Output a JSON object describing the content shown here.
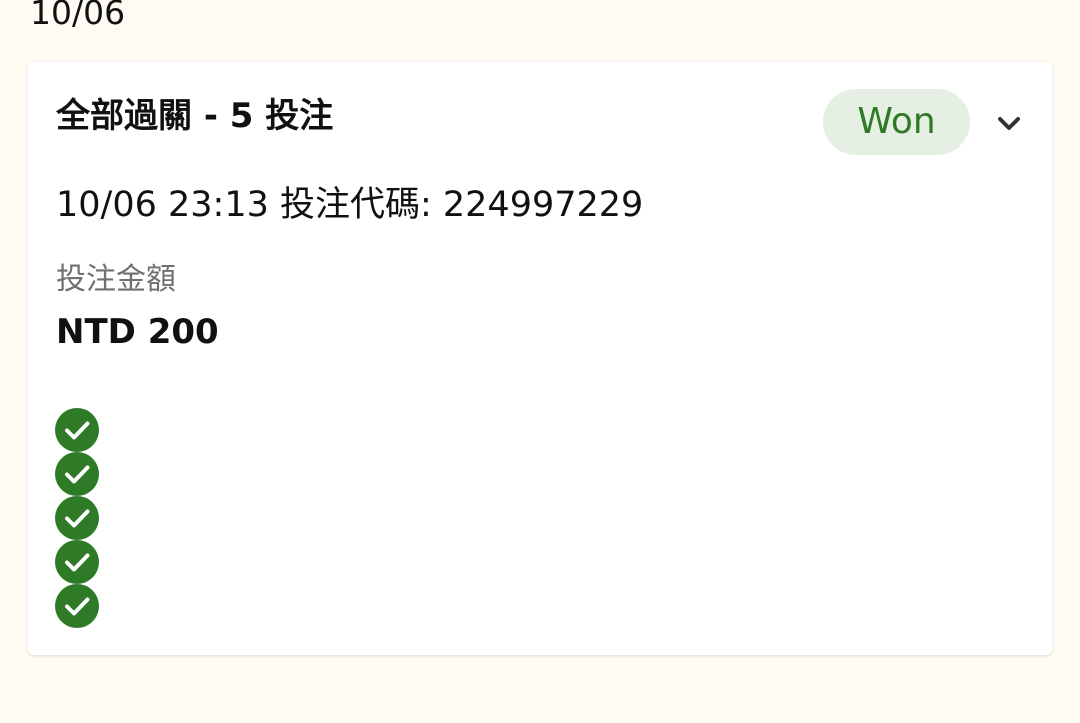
{
  "date_header": "10/06",
  "bet": {
    "title": "全部過關 - 5 投注",
    "status": "Won",
    "meta": "10/06 23:13 投注代碼: 224997229",
    "stake_label": "投注金額",
    "stake_value": "NTD 200",
    "legs": [
      {
        "icon": "check-circle-icon",
        "result": "won"
      },
      {
        "icon": "check-circle-icon",
        "result": "won"
      },
      {
        "icon": "check-circle-icon",
        "result": "won"
      },
      {
        "icon": "check-circle-icon",
        "result": "won"
      },
      {
        "icon": "check-circle-icon",
        "result": "won"
      }
    ]
  },
  "colors": {
    "page_background": "#fefbf3",
    "card_background": "#ffffff",
    "won_badge_background": "#e6efe4",
    "won_text": "#2f7a26",
    "check_green": "#2e7a27",
    "muted_text": "#707070"
  },
  "icons": {
    "expand": "chevron-down-icon",
    "leg_won": "check-circle-icon"
  }
}
